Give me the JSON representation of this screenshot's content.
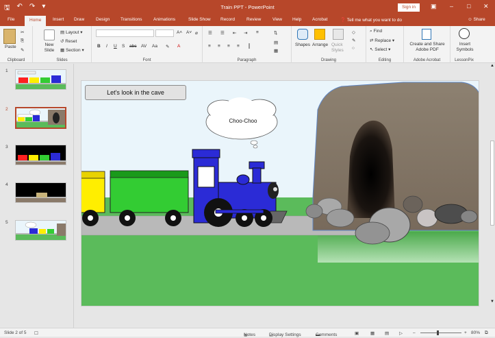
{
  "window": {
    "doc_title": "Train PPT - PowerPoint",
    "sign_in": "Sign in"
  },
  "tabs": [
    "File",
    "Home",
    "Insert",
    "Draw",
    "Design",
    "Transitions",
    "Animations",
    "Slide Show",
    "Record",
    "Review",
    "View",
    "Help",
    "Acrobat"
  ],
  "active_tab": "Home",
  "tell_me": "Tell me what you want to do",
  "share": "Share",
  "ribbon": {
    "clipboard": {
      "paste": "Paste",
      "label": "Clipboard"
    },
    "slides": {
      "new_slide": "New Slide",
      "layout": "Layout",
      "reset": "Reset",
      "section": "Section",
      "label": "Slides"
    },
    "font": {
      "label": "Font"
    },
    "paragraph": {
      "label": "Paragraph"
    },
    "drawing": {
      "shapes": "Shapes",
      "arrange": "Arrange",
      "quick_styles": "Quick Styles",
      "label": "Drawing"
    },
    "editing": {
      "find": "Find",
      "replace": "Replace",
      "select": "Select",
      "label": "Editing"
    },
    "acrobat": {
      "create": "Create and Share Adobe PDF",
      "label": "Adobe Acrobat"
    },
    "lessonpix": {
      "insert": "Insert Symbols",
      "label": "LessonPix"
    }
  },
  "thumbnails": [
    {
      "num": "1",
      "selected": false
    },
    {
      "num": "2",
      "selected": true
    },
    {
      "num": "3",
      "selected": false
    },
    {
      "num": "4",
      "selected": false
    },
    {
      "num": "5",
      "selected": false
    }
  ],
  "slide": {
    "caption": "Let's look in the cave",
    "thought": "Choo-Choo"
  },
  "status": {
    "slide_of": "Slide 2 of 5",
    "notes": "Notes",
    "display_settings": "Display Settings",
    "comments": "Comments",
    "zoom": "80%",
    "zoom_level": 0.8
  },
  "colors": {
    "accent": "#b7472a",
    "grass": "#5bbb5b",
    "track": "#b9b9b9",
    "engine": "#2b2bd6",
    "car_green": "#33cc33",
    "car_yellow": "#ffee00"
  }
}
